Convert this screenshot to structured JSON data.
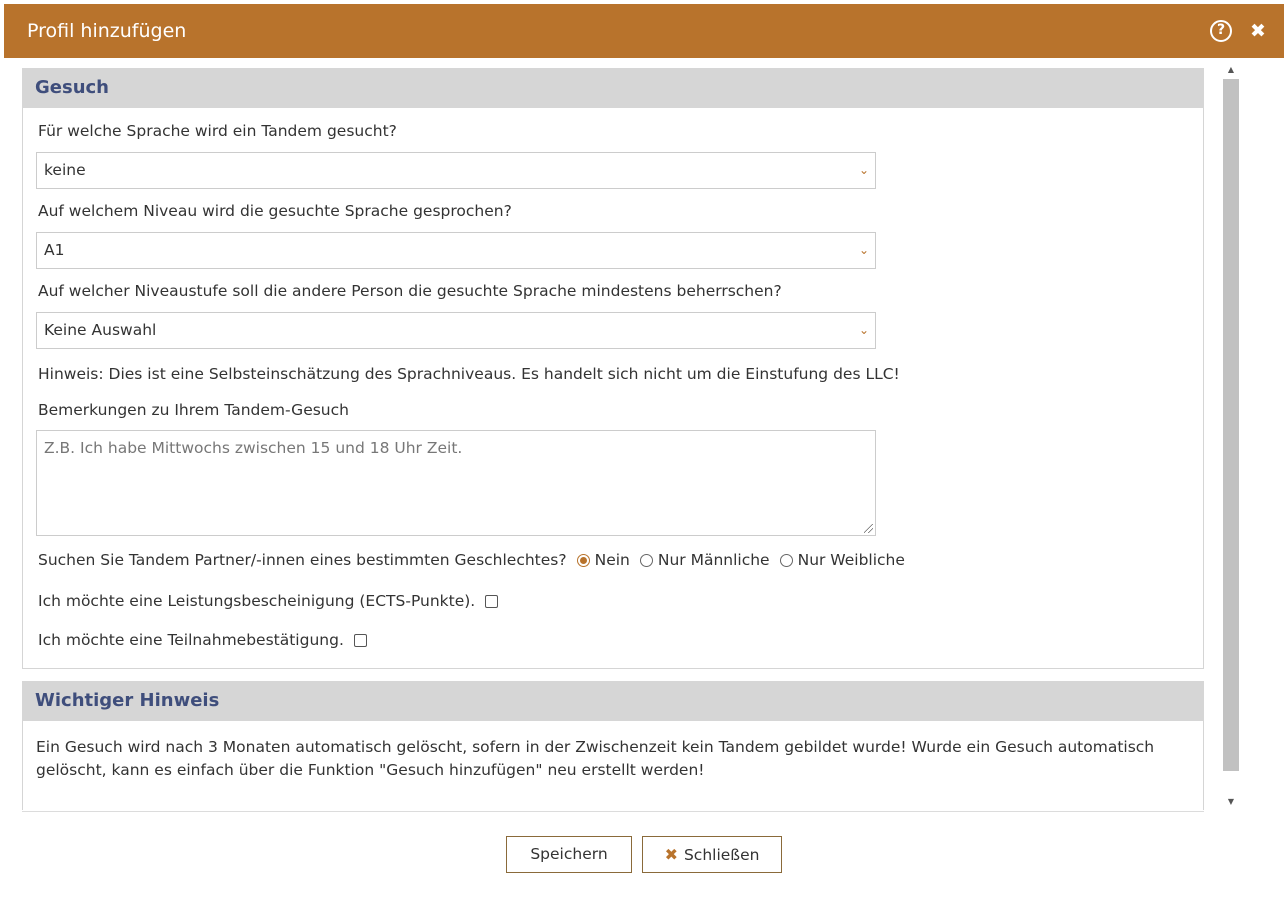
{
  "dialog": {
    "title": "Profil hinzufügen",
    "help_icon": "?",
    "close_icon": "✖"
  },
  "gesuch": {
    "heading": "Gesuch",
    "language_label": "Für welche Sprache wird ein Tandem gesucht?",
    "language_value": "keine",
    "level_label": "Auf welchem Niveau wird die gesuchte Sprache gesprochen?",
    "level_value": "A1",
    "min_level_label": "Auf welcher Niveaustufe soll die andere Person die gesuchte Sprache mindestens beherrschen?",
    "min_level_value": "Keine Auswahl",
    "self_assessment_note": "Hinweis: Dies ist eine Selbsteinschätzung des Sprachniveaus. Es handelt sich nicht um die Einstufung des LLC!",
    "remarks_label": "Bemerkungen zu Ihrem Tandem-Gesuch",
    "remarks_placeholder": "Z.B. Ich habe Mittwochs zwischen 15 und 18 Uhr Zeit.",
    "gender_question": "Suchen Sie Tandem Partner/-innen eines bestimmten Geschlechtes?",
    "gender_options": [
      "Nein",
      "Nur Männliche",
      "Nur Weibliche"
    ],
    "gender_selected": "Nein",
    "ects_label": "Ich möchte eine Leistungsbescheinigung (ECTS-Punkte).",
    "ects_checked": false,
    "participation_label": "Ich möchte eine Teilnahmebestätigung.",
    "participation_checked": false
  },
  "hinweis": {
    "heading": "Wichtiger Hinweis",
    "text": "Ein Gesuch wird nach 3 Monaten automatisch gelöscht, sofern in der Zwischenzeit kein Tandem gebildet wurde! Wurde ein Gesuch automatisch gelöscht, kann es einfach über die Funktion \"Gesuch hinzufügen\" neu erstellt werden!"
  },
  "footer": {
    "save_label": "Speichern",
    "close_label": "Schließen",
    "close_icon": "✖"
  },
  "colors": {
    "accent": "#b8732c",
    "heading_text": "#3f4e7c",
    "panel_header": "#d6d6d6"
  }
}
